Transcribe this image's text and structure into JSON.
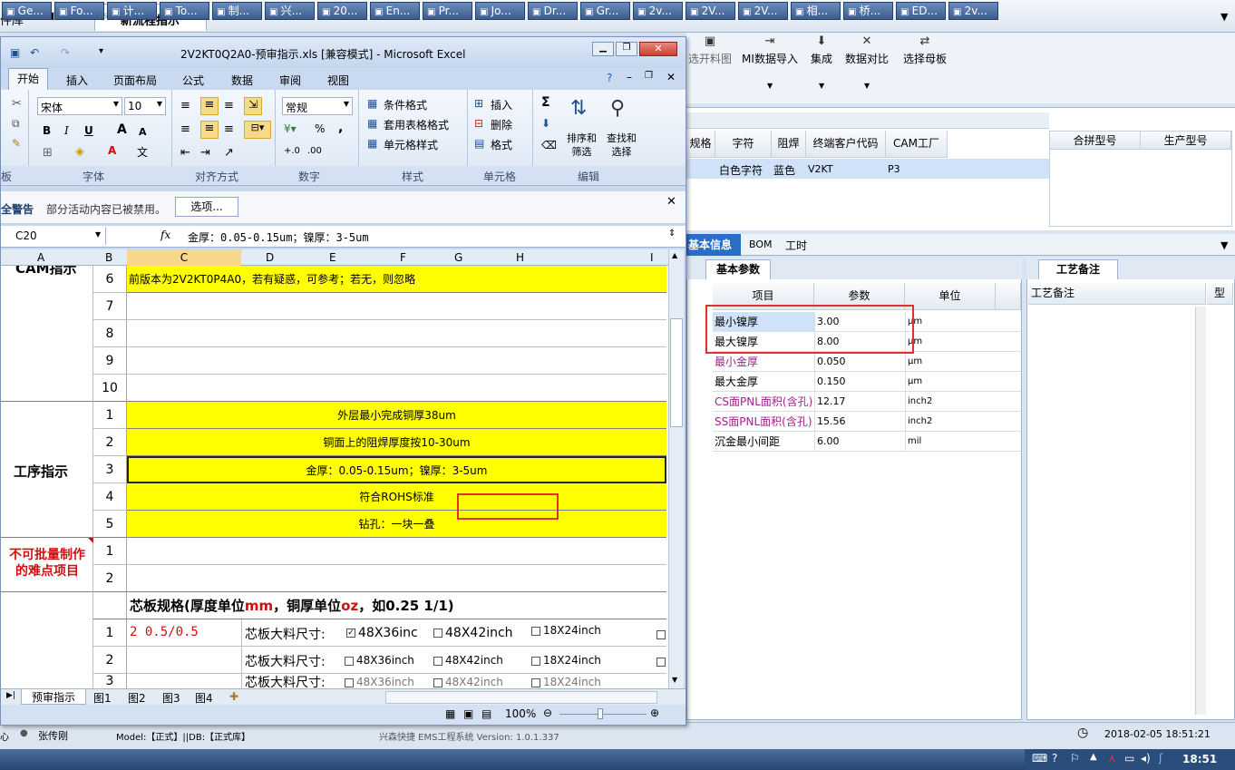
{
  "app": {
    "left_tab": "件库",
    "active_tab": "新流程指示",
    "tab_close": "×",
    "toolbar": [
      "选开料图",
      "MI数据导入",
      "集成",
      "数据对比",
      "选择母板"
    ],
    "status_model": "Model:【正式】||DB:【正式库】",
    "status_user": "张传刚",
    "status_center": "兴森快捷 EMS工程系统 Version: 1.0.1.337",
    "status_time": "2018-02-05 18:51:21",
    "grid_headers": [
      "规格",
      "字符",
      "阻焊",
      "终端客户代码",
      "CAM工厂"
    ],
    "grid_row": [
      "白色字符",
      "蓝色",
      "V2KT",
      "P3"
    ],
    "merge_headers": [
      "合拼型号",
      "生产型号"
    ],
    "tabs": [
      "基本信息",
      "BOM",
      "工时"
    ],
    "param_tab": "基本参数",
    "param_headers": [
      "项目",
      "参数",
      "单位"
    ],
    "params": [
      {
        "item": "最小镍厚",
        "value": "3.00",
        "unit": "μm",
        "color": "#000000"
      },
      {
        "item": "最大镍厚",
        "value": "8.00",
        "unit": "μm",
        "color": "#000000"
      },
      {
        "item": "最小金厚",
        "value": "0.050",
        "unit": "μm",
        "color": "#a0238a"
      },
      {
        "item": "最大金厚",
        "value": "0.150",
        "unit": "μm",
        "color": "#000000"
      },
      {
        "item": "CS面PNL面积(含孔)",
        "value": "12.17",
        "unit": "inch2",
        "color": "#a0238a"
      },
      {
        "item": "SS面PNL面积(含孔)",
        "value": "15.56",
        "unit": "inch2",
        "color": "#a0238a"
      },
      {
        "item": "沉金最小间距",
        "value": "6.00",
        "unit": "mil",
        "color": "#000000"
      }
    ],
    "craft_tab": "工艺备注",
    "craft_header": "工艺备注",
    "craft_side": "型"
  },
  "excel": {
    "title": "2V2KT0Q2A0-预审指示.xls [兼容模式] - Microsoft Excel",
    "ribbon_tabs": [
      "开始",
      "插入",
      "页面布局",
      "公式",
      "数据",
      "审阅",
      "视图"
    ],
    "font_name": "宋体",
    "font_size": "10",
    "number_format": "常规",
    "styles_items": [
      "条件格式",
      "套用表格格式",
      "单元格样式"
    ],
    "cells_items": [
      "插入",
      "删除",
      "格式"
    ],
    "sort_label": "排序和\n筛选",
    "find_label": "查找和\n选择",
    "group_labels": [
      "板",
      "字体",
      "对齐方式",
      "数字",
      "样式",
      "单元格",
      "编辑"
    ],
    "security_title": "全警告",
    "security_text": "部分活动内容已被禁用。",
    "security_button": "选项...",
    "name_box": "C20",
    "formula": "金厚：0.05-0.15um；镍厚：3-5um",
    "columns": [
      "A",
      "B",
      "C",
      "D",
      "E",
      "F",
      "G",
      "H",
      "I"
    ],
    "section1_label": "CAM指示",
    "section2_label": "工序指示",
    "section3_label": "不可批量制作\n的难点项目",
    "row6_text": "前版本为2V2KT0P4A0，若有疑惑，可参考；若无，则忽略",
    "s1_rows": [
      "6",
      "7",
      "8",
      "9",
      "10"
    ],
    "s2_rows": [
      "1",
      "2",
      "3",
      "4",
      "5"
    ],
    "s2_texts": [
      "外层最小完成铜厚38um",
      "铜面上的阻焊厚度按10-30um",
      "金厚：0.05-0.15um；镍厚：3-5um",
      "符合ROHS标准",
      "钻孔：一块一叠"
    ],
    "s3_rows": [
      "1",
      "2"
    ],
    "core_title_a": "芯板规格(厚度单位",
    "core_title_mm": "mm",
    "core_title_b": "，铜厚单位",
    "core_title_oz": "oz",
    "core_title_c": "，如0.25 1/1)",
    "core_rows": [
      "1",
      "2",
      "3"
    ],
    "core_val1": "2 0.5/0.5",
    "core_label": "芯板大料尺寸:",
    "core_opts": [
      "48X36inch",
      "48X42inch",
      "18X24inch"
    ],
    "core_opt_big1": "48X36inc",
    "core_opt_big2": "48X42inch",
    "sheets": [
      "预审指示",
      "图1",
      "图2",
      "图3",
      "图4"
    ],
    "zoom": "100%"
  },
  "taskbar": {
    "items": [
      "Ge...",
      "Fo...",
      "计...",
      "To...",
      "制...",
      "兴...",
      "20...",
      "En...",
      "Pr...",
      "Jo...",
      "Dr...",
      "Gr...",
      "2v...",
      "2V...",
      "2V...",
      "相...",
      "桥...",
      "ED...",
      "2v..."
    ],
    "clock": "18:51"
  }
}
